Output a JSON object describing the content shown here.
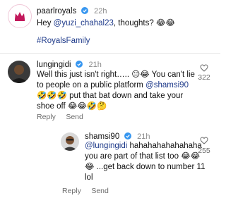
{
  "post": {
    "username": "paarlroyals",
    "time": "22h",
    "text_pre": "Hey ",
    "mention": "@yuzi_chahal23",
    "text_post": ", thoughts? 😂😂",
    "hashtag": "#RoyalsFamily",
    "avatar_color": "#c2185b"
  },
  "comment1": {
    "username": "lungingidi",
    "time": "21h",
    "line1": "Well this just isn't right….. 😐😂 You can't lie",
    "line2_pre": "to people on a public platform ",
    "mention": "@shamsi90",
    "line3": "🤣🤣🤣 put that bat down and take your",
    "line4": "shoe off 😂😂🤣🤔",
    "likes": "322",
    "reply_label": "Reply",
    "send_label": "Send"
  },
  "comment2": {
    "username": "shamsi90",
    "time": "21h",
    "mention": "@lungingidi",
    "line1_post": " hahahahahahahaha",
    "line2": "you are part of that list too 😂😂",
    "line3": "😂 ...get back down to number 11",
    "line4": "lol",
    "likes": "255",
    "reply_label": "Reply",
    "send_label": "Send"
  },
  "colors": {
    "verified": "#3897f0",
    "link": "#1e3a8a",
    "muted": "#6b6b6b"
  }
}
